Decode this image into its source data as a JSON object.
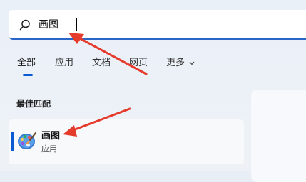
{
  "search": {
    "query": "画图",
    "placeholder": "画图"
  },
  "tabs": [
    {
      "label": "全部",
      "active": true
    },
    {
      "label": "应用",
      "active": false
    },
    {
      "label": "文档",
      "active": false
    },
    {
      "label": "网页",
      "active": false
    },
    {
      "label": "更多",
      "active": false
    }
  ],
  "best_match": {
    "section_title": "最佳匹配",
    "app_name": "画图",
    "app_type": "应用",
    "app_icon": "paint-palette-icon"
  },
  "colors": {
    "accent": "#0a5bd3",
    "annotation_arrow": "#e53b2c"
  }
}
